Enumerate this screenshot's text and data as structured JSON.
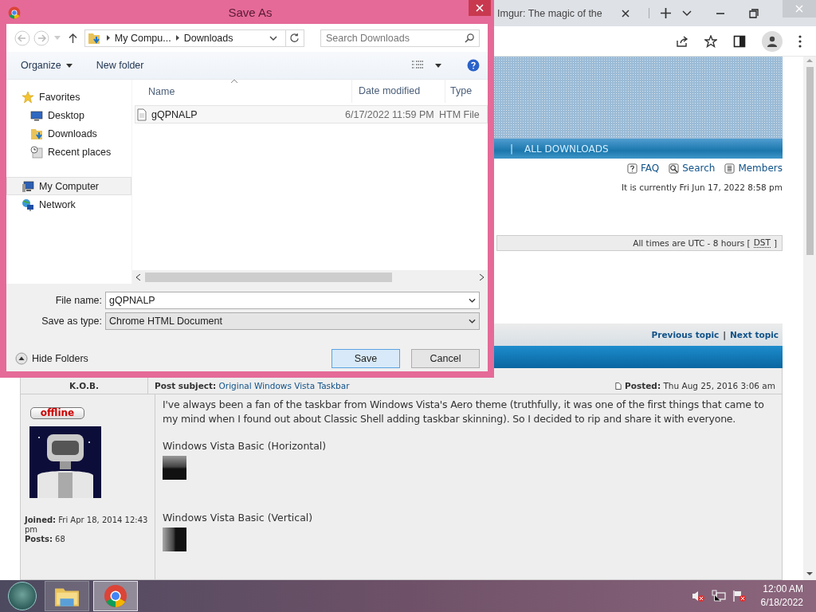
{
  "browser": {
    "tab": {
      "title": "Imgur: The magic of the"
    },
    "forum": {
      "nav_separator": "|",
      "nav_link": "ALL DOWNLOADS",
      "links": [
        {
          "label": "FAQ",
          "kind": "faq"
        },
        {
          "label": "Search",
          "kind": "search"
        },
        {
          "label": "Members",
          "kind": "members"
        }
      ],
      "current_time": "It is currently Fri Jun 17, 2022 8:58 pm",
      "timezone": {
        "prefix": "All times are UTC - 8 hours [",
        "abbr": "DST",
        "suffix": "]"
      },
      "topic_nav": {
        "previous": "Previous topic",
        "separator": "|",
        "next": "Next topic"
      },
      "post": {
        "author": "K.O.B.",
        "subject_label": "Post subject:",
        "subject": "Original Windows Vista Taskbar",
        "posted_label": "Posted:",
        "posted": "Thu Aug 25, 2016 3:06 am",
        "status": "offline",
        "joined_label": "Joined:",
        "joined": "Fri Apr 18, 2014 12:43 pm",
        "posts_label": "Posts:",
        "posts": "68",
        "body": [
          {
            "kind": "paragraph",
            "text": "I've always been a fan of the taskbar from Windows Vista's Aero theme (truthfully, it was one of the first things that came to my mind when I found out about Classic Shell adding taskbar skinning). So I decided to rip and share it with everyone."
          },
          {
            "kind": "caption",
            "text": "Windows Vista Basic (Horizontal)"
          },
          {
            "kind": "hswatch"
          },
          {
            "kind": "caption",
            "text": "Windows Vista Basic (Vertical)"
          },
          {
            "kind": "vswatch"
          }
        ]
      }
    }
  },
  "dialog": {
    "title": "Save As",
    "path": [
      "My Compu...",
      "Downloads"
    ],
    "search": {
      "placeholder": "Search Downloads"
    },
    "organize": "Organize",
    "new_folder": "New folder",
    "nav": [
      {
        "label": "Favorites",
        "kind": "star",
        "selected": false,
        "children": [
          {
            "label": "Desktop",
            "kind": "desktop",
            "selected": false
          },
          {
            "label": "Downloads",
            "kind": "downloads",
            "selected": false
          },
          {
            "label": "Recent places",
            "kind": "recent",
            "selected": false
          }
        ]
      },
      {
        "label": "My Computer",
        "kind": "computer",
        "selected": true
      },
      {
        "label": "Network",
        "kind": "network",
        "selected": false
      }
    ],
    "columns": [
      "Name",
      "Date modified",
      "Type"
    ],
    "files": [
      {
        "name": "gQPNALP",
        "date": "6/17/2022 11:59 PM",
        "type": "HTM File"
      }
    ],
    "file_name_label": "File name:",
    "file_name": "gQPNALP",
    "type_label": "Save as type:",
    "save_type": "Chrome HTML Document",
    "hide_folders": "Hide Folders",
    "buttons": [
      {
        "label": "Save",
        "default": true
      },
      {
        "label": "Cancel",
        "default": false
      }
    ]
  },
  "taskbar": {
    "apps": [
      {
        "kind": "explorer",
        "active": false
      },
      {
        "kind": "chrome",
        "active": true
      }
    ],
    "time": "12:00 AM",
    "date": "6/18/2022"
  }
}
